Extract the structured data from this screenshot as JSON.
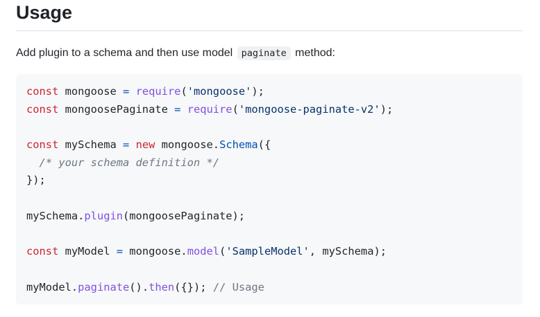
{
  "heading": "Usage",
  "intro": {
    "before": "Add plugin to a schema and then use model",
    "code": "paginate",
    "after": "method:"
  },
  "code": {
    "l1": {
      "kw": "const",
      "name": " mongoose ",
      "op": "=",
      "sp": " ",
      "fn": "require",
      "p1": "(",
      "str": "'mongoose'",
      "p2": ");"
    },
    "l2": {
      "kw": "const",
      "name": " mongoosePaginate ",
      "op": "=",
      "sp": " ",
      "fn": "require",
      "p1": "(",
      "str": "'mongoose-paginate-v2'",
      "p2": ");"
    },
    "l4": {
      "kw": "const",
      "name": " mySchema ",
      "op": "=",
      "sp": " ",
      "kw2": "new",
      "obj": " mongoose.",
      "cls": "Schema",
      "p": "({"
    },
    "l5": {
      "indent": "  ",
      "comment": "/* your schema definition */"
    },
    "l6": "});",
    "l8": {
      "obj": "mySchema.",
      "fn": "plugin",
      "rest": "(mongoosePaginate);"
    },
    "l10": {
      "kw": "const",
      "name": " myModel ",
      "op": "=",
      "obj": " mongoose.",
      "fn": "model",
      "p1": "(",
      "str": "'SampleModel'",
      "rest": ", mySchema);"
    },
    "l12": {
      "obj": "myModel.",
      "fn1": "paginate",
      "mid": "().",
      "fn2": "then",
      "rest": "({}); ",
      "comment": "// Usage"
    }
  }
}
